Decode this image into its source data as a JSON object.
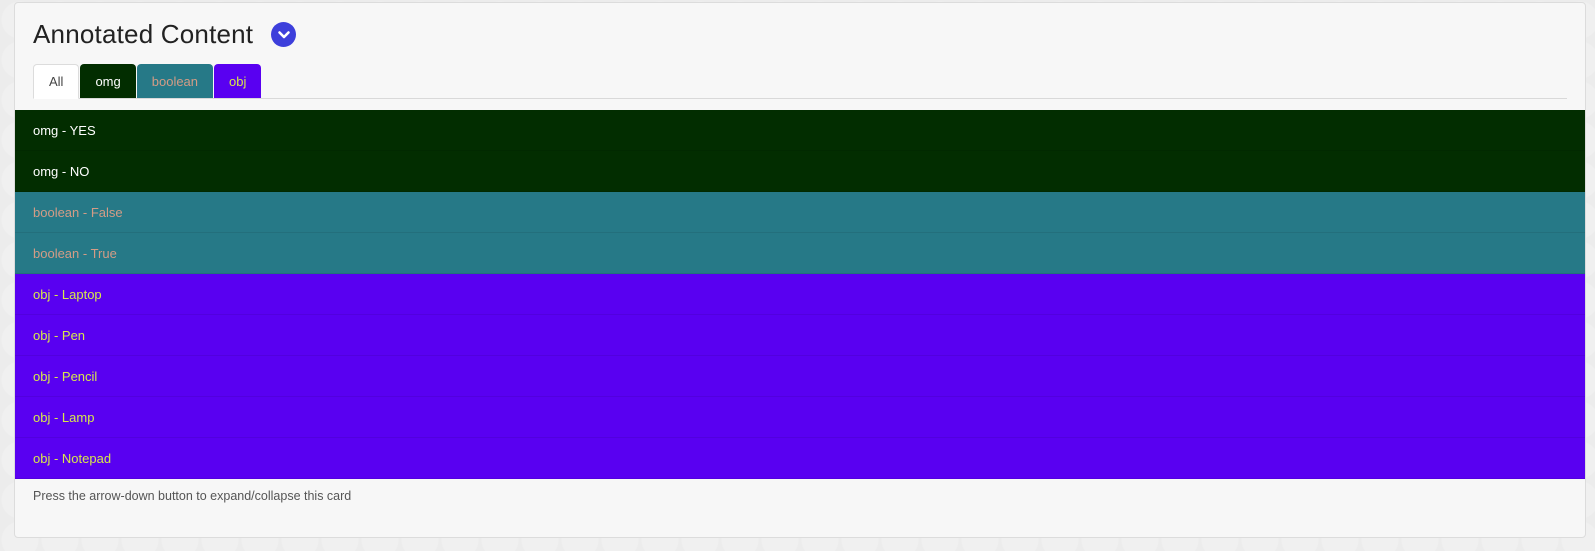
{
  "card": {
    "title": "Annotated Content",
    "footer": "Press the arrow-down button to expand/collapse this card"
  },
  "icons": {
    "toggle": "chevron-down-icon"
  },
  "tabs": [
    {
      "label": "All",
      "bg": "#ffffff",
      "fg": "#444444"
    },
    {
      "label": "omg",
      "bg": "#022d00",
      "fg": "#ffffff"
    },
    {
      "label": "boolean",
      "bg": "#267987",
      "fg": "#d39c86"
    },
    {
      "label": "obj",
      "bg": "#5900f1",
      "fg": "#d7e84a"
    }
  ],
  "rows": [
    {
      "text": "omg - YES",
      "group": "omg"
    },
    {
      "text": "omg - NO",
      "group": "omg"
    },
    {
      "text": "boolean - False",
      "group": "boolean"
    },
    {
      "text": "boolean - True",
      "group": "boolean"
    },
    {
      "text": "obj - Laptop",
      "group": "obj"
    },
    {
      "text": "obj - Pen",
      "group": "obj"
    },
    {
      "text": "obj - Pencil",
      "group": "obj"
    },
    {
      "text": "obj - Lamp",
      "group": "obj"
    },
    {
      "text": "obj - Notepad",
      "group": "obj"
    }
  ],
  "colors": {
    "omg": {
      "bg": "#022d00",
      "fg": "#ffffff"
    },
    "boolean": {
      "bg": "#267987",
      "fg": "#d39c86"
    },
    "obj": {
      "bg": "#5900f1",
      "fg": "#d7e84a"
    },
    "accent": "#3d3fdb"
  }
}
